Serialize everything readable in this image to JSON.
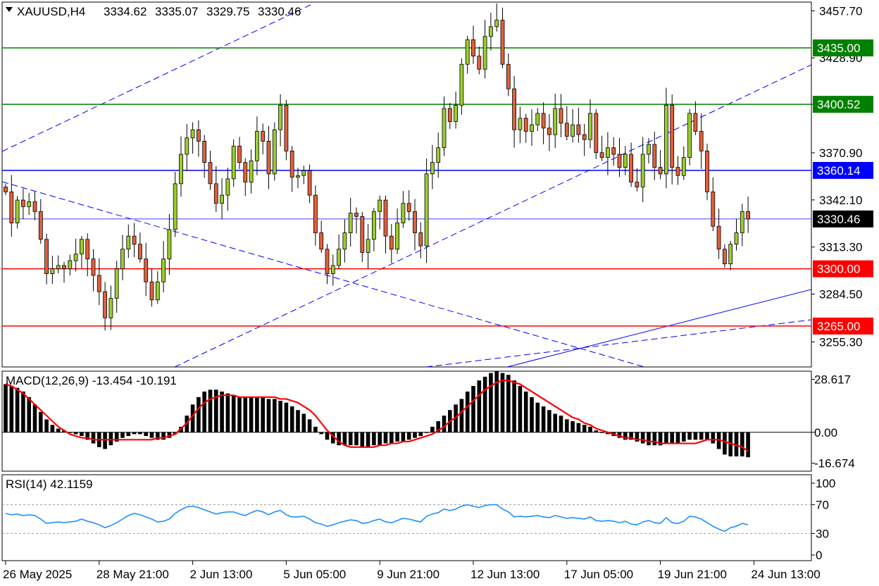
{
  "chart_data": [
    {
      "type": "candlestick",
      "header": {
        "symbol": "XAUUSD,H4",
        "open": "3334.62",
        "high": "3335.07",
        "low": "3329.75",
        "close": "3330.46"
      },
      "ylim": [
        3240,
        3463
      ],
      "yticks": [
        "3457.70",
        "3428.90",
        "3400.52",
        "3370.90",
        "3342.10",
        "3313.30",
        "3284.50",
        "3255.30"
      ],
      "current_price": {
        "value": 3330.46,
        "label": "3330.46"
      },
      "levels": [
        {
          "value": 3435.0,
          "label": "3435.00",
          "color": "#008000"
        },
        {
          "value": 3400.52,
          "label": "3400.52",
          "color": "#008000"
        },
        {
          "value": 3360.14,
          "label": "3360.14",
          "color": "#0000ff"
        },
        {
          "value": 3300.0,
          "label": "3300.00",
          "color": "#ff0000"
        },
        {
          "value": 3265.0,
          "label": "3265.00",
          "color": "#ff0000"
        }
      ],
      "bull_color": "#9acd32",
      "bear_color": "#e0603c",
      "closes": [
        3347,
        3328,
        3342,
        3338,
        3341,
        3335,
        3318,
        3297,
        3300,
        3302,
        3300,
        3305,
        3309,
        3318,
        3306,
        3296,
        3286,
        3270,
        3282,
        3300,
        3312,
        3320,
        3315,
        3306,
        3292,
        3281,
        3292,
        3306,
        3324,
        3352,
        3370,
        3380,
        3385,
        3378,
        3365,
        3352,
        3340,
        3345,
        3355,
        3375,
        3365,
        3353,
        3366,
        3384,
        3378,
        3358,
        3385,
        3400,
        3372,
        3356,
        3357,
        3360,
        3345,
        3322,
        3312,
        3297,
        3302,
        3312,
        3322,
        3334,
        3332,
        3310,
        3318,
        3335,
        3342,
        3320,
        3312,
        3328,
        3340,
        3335,
        3322,
        3314,
        3358,
        3365,
        3374,
        3398,
        3390,
        3400,
        3425,
        3440,
        3430,
        3422,
        3442,
        3448,
        3452,
        3425,
        3410,
        3385,
        3392,
        3384,
        3388,
        3395,
        3386,
        3382,
        3398,
        3389,
        3381,
        3388,
        3382,
        3379,
        3395,
        3371,
        3368,
        3374,
        3370,
        3362,
        3370,
        3353,
        3350,
        3370,
        3376,
        3362,
        3358,
        3400,
        3362,
        3357,
        3368,
        3395,
        3384,
        3372,
        3347,
        3326,
        3312,
        3303,
        3315,
        3322,
        3335,
        3330.46
      ]
    },
    {
      "type": "macd",
      "label": "MACD(12,26,9) -13.454 -10.191",
      "ylim": [
        -21,
        33
      ],
      "yticks": [
        "28.617",
        "0.00",
        "-16.674"
      ],
      "histogram_color": "#000000",
      "signal_color": "#ff0000",
      "histogram": [
        26,
        25,
        24,
        22,
        19,
        15,
        11,
        7,
        4,
        2,
        1,
        0,
        -1,
        -2,
        -4,
        -6,
        -8,
        -9,
        -7,
        -5,
        -3,
        -2,
        -1,
        -1,
        -2,
        -3,
        -4,
        -4,
        -3,
        -1,
        3,
        9,
        15,
        19,
        22,
        23,
        23,
        22,
        21,
        20,
        19,
        19,
        19,
        19,
        19,
        18,
        18,
        17,
        16,
        14,
        12,
        10,
        7,
        3,
        -1,
        -4,
        -6,
        -7,
        -7,
        -7,
        -7,
        -8,
        -8,
        -7,
        -7,
        -6,
        -6,
        -5,
        -5,
        -4,
        -3,
        -2,
        0,
        3,
        6,
        9,
        12,
        15,
        18,
        22,
        25,
        28,
        30,
        32,
        33,
        32,
        31,
        28,
        25,
        22,
        19,
        16,
        14,
        12,
        10,
        9,
        7,
        6,
        5,
        4,
        3,
        1,
        0,
        -1,
        -2,
        -3,
        -4,
        -4,
        -5,
        -6,
        -7,
        -7,
        -7,
        -6,
        -6,
        -6,
        -5,
        -4,
        -4,
        -4,
        -4,
        -6,
        -9,
        -12,
        -13,
        -13,
        -13,
        -13.454
      ],
      "signal": [
        26,
        25,
        23,
        21,
        18,
        15,
        12,
        9,
        6,
        3,
        1,
        -1,
        -2,
        -3,
        -3,
        -4,
        -4,
        -4,
        -4,
        -4,
        -4,
        -4,
        -4,
        -4,
        -4,
        -4,
        -3,
        -3,
        -2,
        -1,
        2,
        5,
        9,
        13,
        16,
        18,
        19,
        20,
        20,
        20,
        19,
        19,
        19,
        19,
        19,
        19,
        19,
        18,
        18,
        17,
        16,
        14,
        12,
        9,
        5,
        1,
        -2,
        -5,
        -7,
        -8,
        -8,
        -8,
        -8,
        -8,
        -7,
        -7,
        -6,
        -6,
        -5,
        -5,
        -4,
        -3,
        -2,
        -1,
        1,
        3,
        6,
        8,
        11,
        14,
        17,
        20,
        23,
        25,
        27,
        28,
        28,
        27,
        26,
        24,
        22,
        20,
        18,
        16,
        14,
        12,
        10,
        8,
        7,
        5,
        4,
        2,
        1,
        0,
        -1,
        -2,
        -3,
        -3,
        -4,
        -4,
        -5,
        -5,
        -6,
        -6,
        -6,
        -6,
        -6,
        -6,
        -6,
        -5,
        -4,
        -4,
        -4,
        -5,
        -6,
        -7,
        -8,
        -10.191
      ]
    },
    {
      "type": "rsi",
      "label": "RSI(14) 42.1159",
      "ylim": [
        0,
        100
      ],
      "yticks": [
        "100",
        "70",
        "30",
        "0"
      ],
      "levels": [
        70,
        30
      ],
      "color": "#1e90ff",
      "values": [
        58,
        56,
        57,
        55,
        56,
        55,
        50,
        44,
        45,
        46,
        45,
        46,
        47,
        50,
        47,
        45,
        42,
        38,
        41,
        45,
        50,
        55,
        58,
        56,
        53,
        50,
        46,
        47,
        50,
        58,
        63,
        67,
        68,
        66,
        63,
        60,
        57,
        59,
        60,
        60,
        57,
        55,
        59,
        62,
        60,
        56,
        60,
        62,
        56,
        53,
        53,
        54,
        50,
        45,
        43,
        40,
        42,
        45,
        47,
        49,
        48,
        44,
        45,
        48,
        50,
        46,
        45,
        48,
        51,
        50,
        48,
        46,
        54,
        57,
        59,
        64,
        62,
        64,
        68,
        70,
        68,
        66,
        69,
        70,
        70,
        64,
        60,
        53,
        54,
        53,
        54,
        55,
        53,
        52,
        55,
        53,
        51,
        52,
        51,
        50,
        53,
        48,
        47,
        48,
        47,
        45,
        47,
        43,
        42,
        46,
        48,
        45,
        44,
        52,
        45,
        44,
        47,
        54,
        53,
        50,
        45,
        40,
        36,
        33,
        38,
        40,
        44,
        42.1159
      ]
    }
  ],
  "time_axis": {
    "labels": [
      "26 May 2025",
      "28 May 21:00",
      "2 Jun 13:00",
      "5 Jun 05:00",
      "9 Jun 21:00",
      "12 Jun 13:00",
      "17 Jun 05:00",
      "19 Jun 21:00",
      "24 Jun 13:00"
    ],
    "indices": [
      0,
      16,
      32,
      48,
      64,
      80,
      96,
      112,
      128
    ]
  }
}
